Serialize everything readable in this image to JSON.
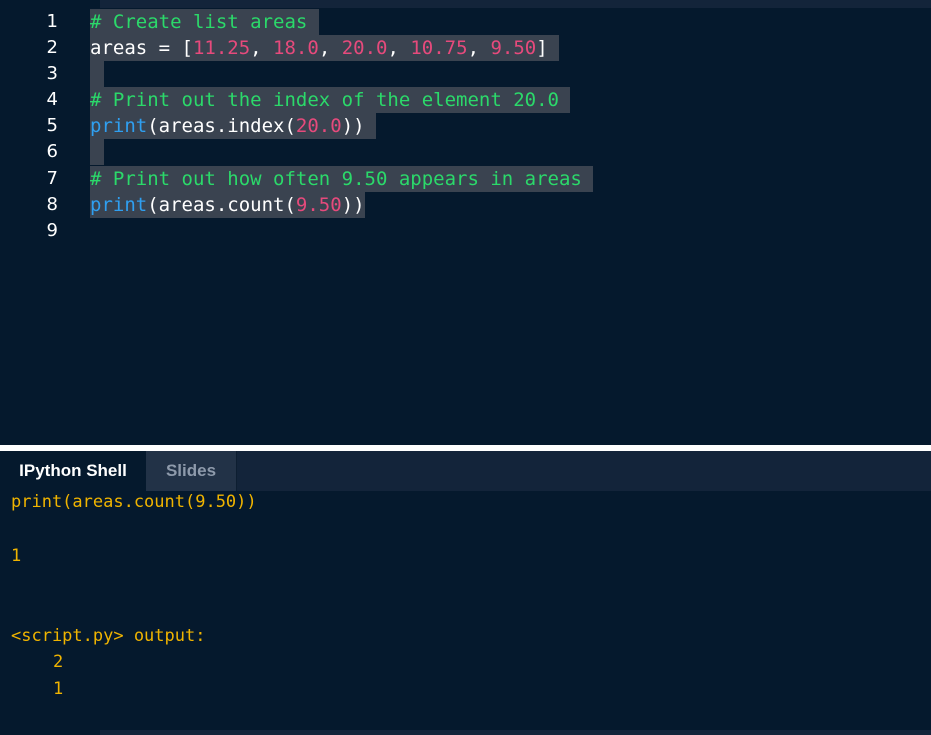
{
  "editor": {
    "line_numbers": [
      "1",
      "2",
      "3",
      "4",
      "5",
      "6",
      "7",
      "8",
      "9"
    ],
    "line1_comment": "# Create list areas",
    "line2": {
      "prefix": "areas = [",
      "n1": "11.25",
      "sep1": ", ",
      "n2": "18.0",
      "sep2": ", ",
      "n3": "20.0",
      "sep3": ", ",
      "n4": "10.75",
      "sep4": ", ",
      "n5": "9.50",
      "suffix": "]"
    },
    "line4_comment": "# Print out the index of the element 20.0",
    "line5": {
      "fn": "print",
      "open": "(areas.index(",
      "num": "20.0",
      "close": "))"
    },
    "line7_comment": "# Print out how often 9.50 appears in areas",
    "line8": {
      "fn": "print",
      "open": "(areas.count(",
      "num": "9.50",
      "close": "))"
    }
  },
  "shell": {
    "tabs": [
      "IPython Shell",
      "Slides"
    ],
    "command": "print(areas.count(9.50))",
    "result": "1",
    "script_header": "<script.py> output:",
    "script_outputs": [
      "2",
      "1"
    ]
  },
  "colors": {
    "background": "#05192d",
    "comment": "#2bd96a",
    "number": "#e64a7c",
    "function": "#2f9ff0",
    "shell_output": "#f0b400",
    "selection": "#3a4350"
  }
}
